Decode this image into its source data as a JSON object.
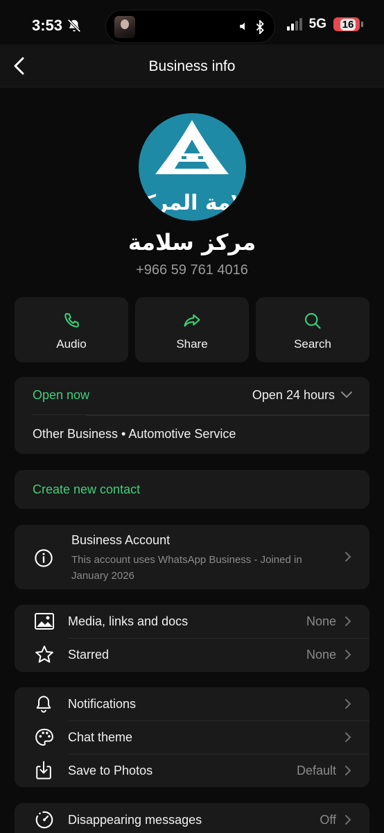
{
  "status_bar": {
    "time": "3:53",
    "network": "5G",
    "battery": "16"
  },
  "nav": {
    "title": "Business info"
  },
  "profile": {
    "avatar_text": "لامة المركز",
    "name": "مركز سلامة",
    "phone": "+966 59 761 4016"
  },
  "actions": [
    {
      "label": "Audio",
      "icon": "phone-icon"
    },
    {
      "label": "Share",
      "icon": "share-icon"
    },
    {
      "label": "Search",
      "icon": "search-icon"
    }
  ],
  "hours": {
    "status": "Open now",
    "schedule": "Open 24 hours",
    "category": "Other Business • Automotive Service"
  },
  "create_contact": "Create new contact",
  "business_account": {
    "title": "Business Account",
    "description": "This account uses WhatsApp Business - Joined in January 2026"
  },
  "media": [
    {
      "label": "Media, links and docs",
      "value": "None",
      "icon": "image-icon"
    },
    {
      "label": "Starred",
      "value": "None",
      "icon": "star-icon"
    }
  ],
  "settings": [
    {
      "label": "Notifications",
      "value": "",
      "icon": "bell-icon"
    },
    {
      "label": "Chat theme",
      "value": "",
      "icon": "palette-icon"
    },
    {
      "label": "Save to Photos",
      "value": "Default",
      "icon": "download-icon"
    }
  ],
  "disappearing": {
    "label": "Disappearing messages",
    "value": "Off",
    "icon": "timer-icon"
  },
  "colors": {
    "accent_green": "#3fcf7a",
    "background": "#0b0b0b",
    "card": "#1a1a1a",
    "avatar_bg": "#1f8aa6"
  }
}
